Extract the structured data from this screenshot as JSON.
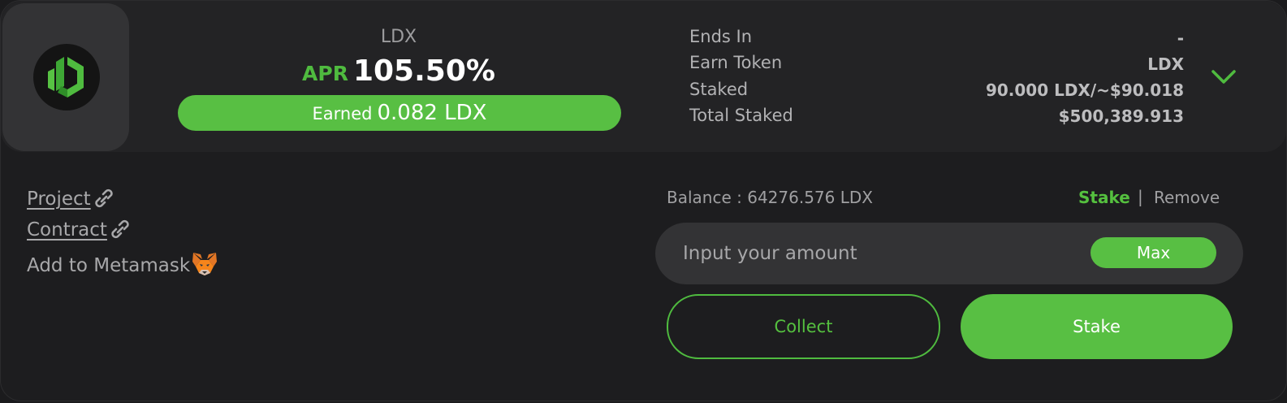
{
  "pool": {
    "token": "LDX",
    "apr_label": "APR",
    "apr_value": "105.50%",
    "earned_label": "Earned",
    "earned_value": "0.082 LDX"
  },
  "info": {
    "ends_in_label": "Ends In",
    "ends_in_value": "-",
    "earn_token_label": "Earn Token",
    "earn_token_value": "LDX",
    "staked_label": "Staked",
    "staked_value": "90.000 LDX/~$90.018",
    "total_staked_label": "Total Staked",
    "total_staked_value": "$500,389.913"
  },
  "links": {
    "project": "Project",
    "contract": "Contract",
    "metamask": "Add to Metamask"
  },
  "stake_panel": {
    "balance": "Balance : 64276.576 LDX",
    "tab_stake": "Stake",
    "tab_separator": "|",
    "tab_remove": "Remove",
    "amount_placeholder": "Input your amount",
    "amount_value": "",
    "max_label": "Max",
    "collect_label": "Collect",
    "stake_label": "Stake"
  },
  "icons": {
    "logo": "ldx-logo-icon",
    "expand": "chevron-down-icon",
    "link": "link-icon",
    "metamask": "fox-icon"
  },
  "colors": {
    "accent": "#58bf43",
    "background": "#1d1d1f",
    "panel": "#232325",
    "input": "#333335"
  }
}
